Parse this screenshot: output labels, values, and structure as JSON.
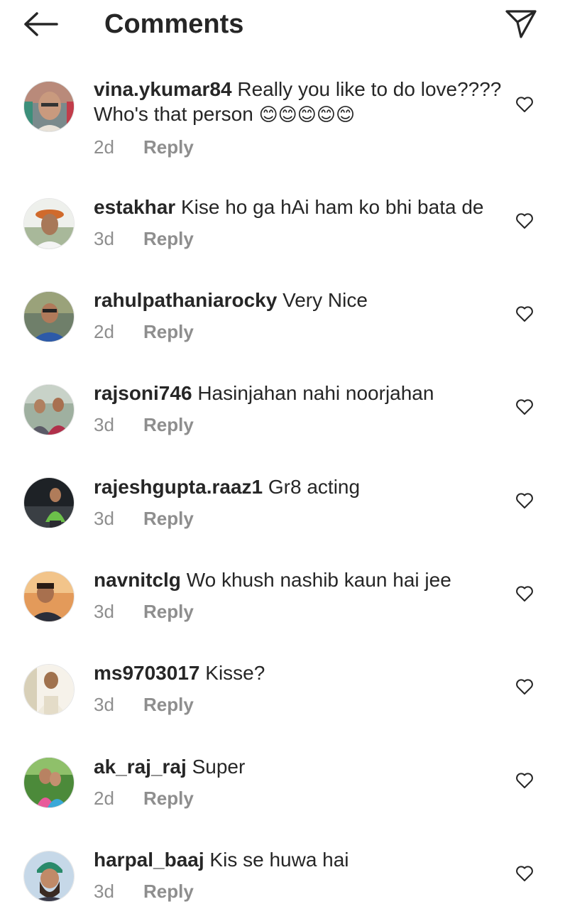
{
  "header": {
    "title": "Comments",
    "back_icon": "arrow-left-icon",
    "share_icon": "send-paper-plane-icon"
  },
  "colors": {
    "text": "#262626",
    "secondary": "#8e8e8e",
    "background": "#ffffff"
  },
  "comments": [
    {
      "username": "vina.ykumar84",
      "text": "Really you like to do love???? Who's that person",
      "emoji": "😊😊😊😊😊",
      "time": "2d",
      "reply": "Reply"
    },
    {
      "username": "estakhar",
      "text": "Kise ho ga hAi ham ko bhi bata de",
      "emoji": "",
      "time": "3d",
      "reply": "Reply"
    },
    {
      "username": "rahulpathaniarocky",
      "text": "Very Nice",
      "emoji": "",
      "time": "2d",
      "reply": "Reply"
    },
    {
      "username": "rajsoni746",
      "text": "Hasinjahan nahi noorjahan",
      "emoji": "",
      "time": "3d",
      "reply": "Reply"
    },
    {
      "username": "rajeshgupta.raaz1",
      "text": "Gr8 acting",
      "emoji": "",
      "time": "3d",
      "reply": "Reply"
    },
    {
      "username": "navnitclg",
      "text": "Wo khush nashib kaun hai jee",
      "emoji": "",
      "time": "3d",
      "reply": "Reply"
    },
    {
      "username": "ms9703017",
      "text": "Kisse?",
      "emoji": "",
      "time": "3d",
      "reply": "Reply"
    },
    {
      "username": "ak_raj_raj",
      "text": "Super",
      "emoji": "",
      "time": "2d",
      "reply": "Reply"
    },
    {
      "username": "harpal_baaj",
      "text": "Kis se huwa hai",
      "emoji": "",
      "time": "3d",
      "reply": "Reply"
    }
  ]
}
